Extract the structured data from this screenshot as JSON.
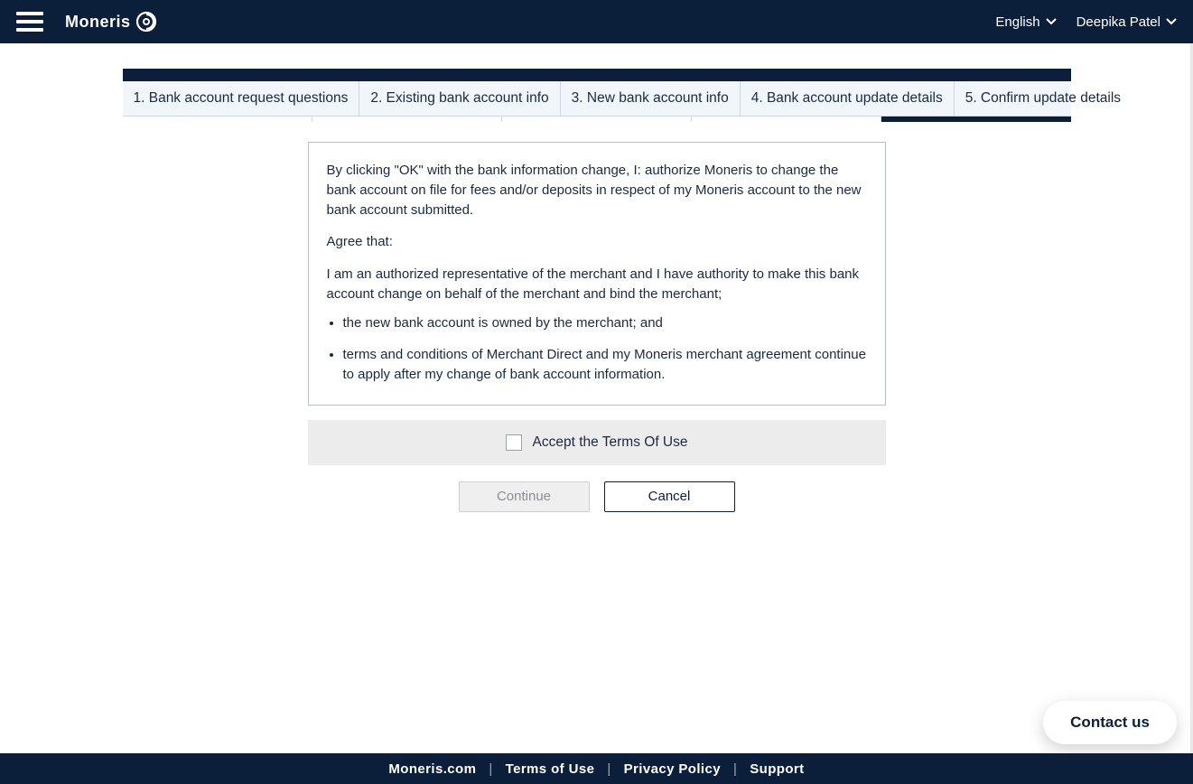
{
  "header": {
    "brand": "Moneris",
    "language_label": "English",
    "user_name": "Deepika Patel"
  },
  "wizard": {
    "steps": [
      {
        "label": "1. Bank account request questions",
        "active": false
      },
      {
        "label": "2. Existing bank account info",
        "active": false
      },
      {
        "label": "3. New bank account info",
        "active": false
      },
      {
        "label": "4. Bank account update details",
        "active": false
      },
      {
        "label": "5. Confirm update details",
        "active": true
      }
    ]
  },
  "card": {
    "intro": "By clicking \"OK\" with the bank information change, I: authorize Moneris to change the bank account on file for fees and/or deposits in respect of my Moneris account to the new bank account submitted.",
    "agree_heading": "Agree that:",
    "auth_text": "I am an authorized representative of the merchant and I have authority to make this bank account change on behalf of the merchant and bind the merchant;",
    "bullet1": "the new bank account is owned by the merchant; and",
    "bullet2": "terms and conditions of Merchant Direct and my Moneris merchant agreement continue to apply after my change of bank account information."
  },
  "accept": {
    "label": "Accept the Terms Of Use",
    "checked": false
  },
  "buttons": {
    "continue": "Continue",
    "cancel": "Cancel"
  },
  "contact_us": "Contact us",
  "footer": {
    "links": [
      "Moneris.com",
      "Terms of Use",
      "Privacy Policy",
      "Support"
    ]
  }
}
